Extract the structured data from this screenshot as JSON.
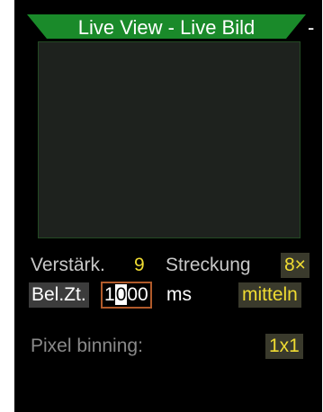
{
  "header": {
    "title": "Live View - Live Bild",
    "trailing": "-"
  },
  "gain": {
    "label": "Verstärk.",
    "value": "9"
  },
  "stretch": {
    "label": "Streckung",
    "value": "8×"
  },
  "exposure": {
    "label": "Bel.Zt.",
    "digits_before": "1",
    "digit_cursor": "0",
    "digits_after": "00",
    "unit": "ms"
  },
  "average": {
    "label": "mitteln"
  },
  "binning": {
    "label": "Pixel binning:",
    "value": "1x1"
  },
  "colors": {
    "title_bar": "#1a8a2a",
    "value_yellow": "#f0dc32",
    "edit_border": "#b05a2a"
  }
}
